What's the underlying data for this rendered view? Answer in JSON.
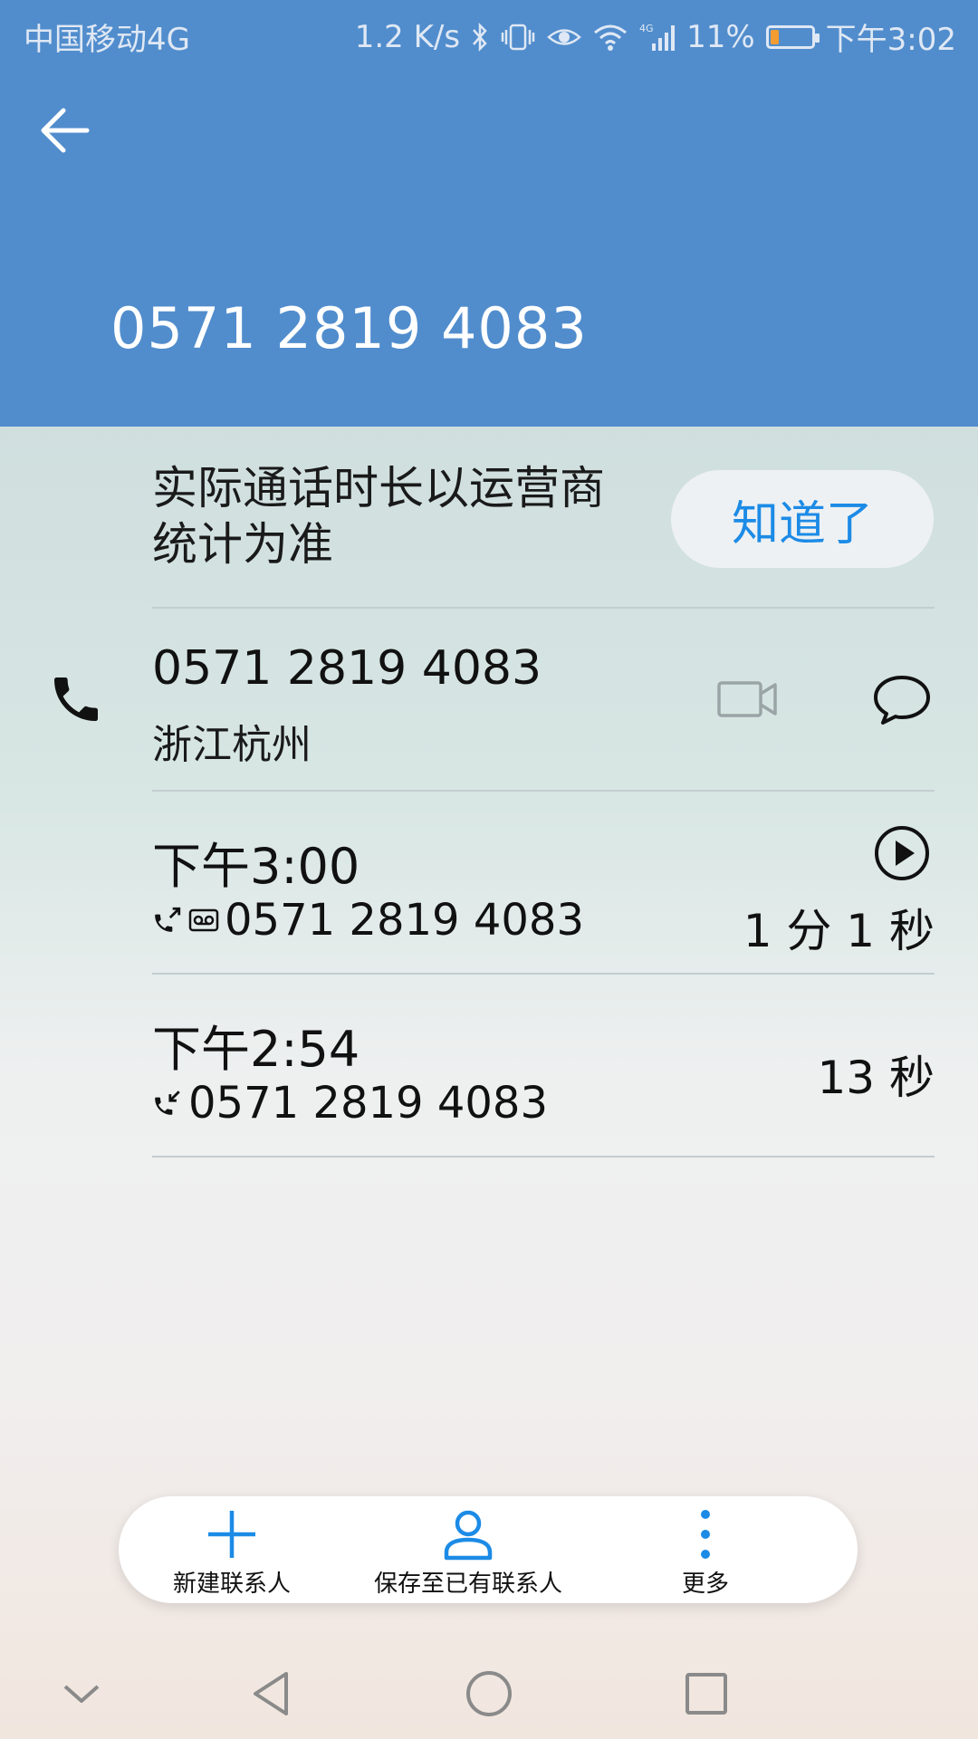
{
  "status_bar": {
    "carrier": "中国移动4G",
    "net_speed": "1.2 K/s",
    "battery_percent": "11%",
    "time": "下午3:02",
    "battery_level": 0.11,
    "icons": [
      "bluetooth-icon",
      "vibrate-icon",
      "eye-icon",
      "wifi-icon",
      "signal-4g-icon",
      "battery-icon"
    ]
  },
  "header": {
    "phone_number": "0571 2819 4083",
    "back_icon": "back-arrow-icon",
    "bg_color": "#518dcd"
  },
  "notice": {
    "text": "实际通话时长以运营商统计为准",
    "button_label": "知道了",
    "accent_color": "#1c8be6"
  },
  "contact": {
    "number": "0571 2819 4083",
    "location": "浙江杭州",
    "icons": [
      "phone-icon",
      "video-call-icon",
      "message-icon"
    ]
  },
  "call_log": [
    {
      "time": "下午3:00",
      "number": "0571 2819 4083",
      "duration": "1 分 1 秒",
      "icons": [
        "outgoing-call-icon",
        "voicemail-icon",
        "play-icon"
      ]
    },
    {
      "time": "下午2:54",
      "number": "0571 2819 4083",
      "duration": "13 秒",
      "icons": [
        "incoming-call-icon"
      ]
    }
  ],
  "bottom_actions": [
    {
      "label": "新建联系人",
      "icon": "plus-icon"
    },
    {
      "label": "保存至已有联系人",
      "icon": "person-icon"
    },
    {
      "label": "更多",
      "icon": "more-vertical-icon"
    }
  ],
  "nav_bar": {
    "icons": [
      "chevron-down-icon",
      "back-triangle-icon",
      "home-circle-icon",
      "recents-square-icon"
    ]
  }
}
